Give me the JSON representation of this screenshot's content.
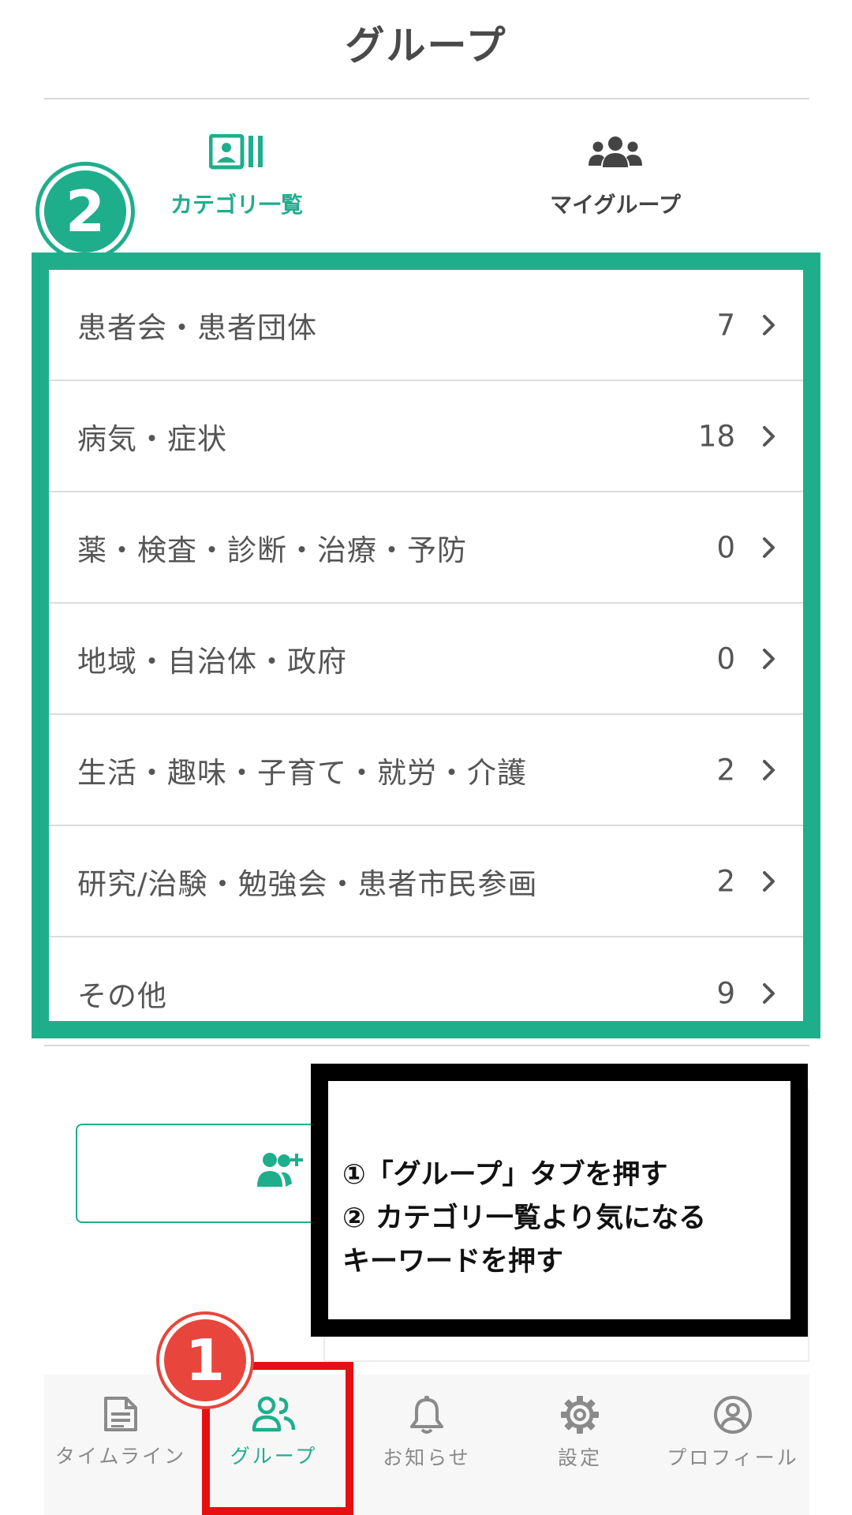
{
  "header": {
    "title": "グループ"
  },
  "tabs": {
    "categories": {
      "label": "カテゴリ一覧",
      "icon": "contact-card-icon"
    },
    "my_groups": {
      "label": "マイグループ",
      "icon": "users-icon"
    }
  },
  "markers": {
    "one": "1",
    "two": "2"
  },
  "categories": [
    {
      "name": "患者会・患者団体",
      "count": "7"
    },
    {
      "name": "病気・症状",
      "count": "18"
    },
    {
      "name": "薬・検査・診断・治療・予防",
      "count": "0"
    },
    {
      "name": "地域・自治体・政府",
      "count": "0"
    },
    {
      "name": "生活・趣味・子育て・就労・介護",
      "count": "2"
    },
    {
      "name": "研究/治験・勉強会・患者市民参画",
      "count": "2"
    },
    {
      "name": "その他",
      "count": "9"
    }
  ],
  "callout": {
    "lines": [
      "①「グループ」タブを押す",
      "② カテゴリ一覧より気になる",
      "キーワードを押す"
    ]
  },
  "bottom_nav": [
    {
      "label": "タイムライン",
      "icon": "document-icon"
    },
    {
      "label": "グループ",
      "icon": "users-icon",
      "active": true
    },
    {
      "label": "お知らせ",
      "icon": "bell-icon"
    },
    {
      "label": "設定",
      "icon": "gear-icon"
    },
    {
      "label": "プロフィール",
      "icon": "user-circle-icon"
    }
  ],
  "colors": {
    "accent": "#1fae8c",
    "highlight_red": "#e80f12",
    "marker_red": "#e8453c",
    "text": "#555555"
  }
}
